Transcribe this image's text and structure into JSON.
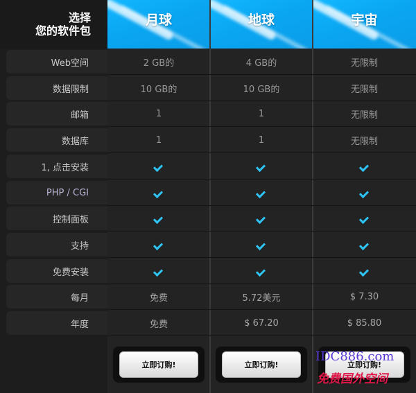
{
  "header": {
    "title_line1": "选择",
    "title_line2": "您的软件包"
  },
  "plans": [
    {
      "name": "月球",
      "values": [
        "2 GB的",
        "10 GB的",
        "1",
        "1"
      ],
      "price_month": "免费",
      "price_year": "免费",
      "button": "立即订购!"
    },
    {
      "name": "地球",
      "values": [
        "4 GB的",
        "10 GB的",
        "1",
        "1"
      ],
      "price_month": "5.72美元",
      "price_year": "$ 67.20",
      "button": "立即订购!"
    },
    {
      "name": "宇宙",
      "values": [
        "无限制",
        "无限制",
        "无限制",
        "无限制"
      ],
      "price_month": "$ 7.30",
      "price_year": "$ 85.80",
      "button": "立即订购!"
    }
  ],
  "features": [
    {
      "label": "Web空间",
      "type": "text",
      "idx": 0
    },
    {
      "label": "数据限制",
      "type": "text",
      "idx": 1
    },
    {
      "label": "邮箱",
      "type": "text",
      "idx": 2
    },
    {
      "label": "数据库",
      "type": "text",
      "idx": 3
    },
    {
      "label": "1, 点击安装",
      "type": "check"
    },
    {
      "label": "PHP / CGI",
      "type": "check"
    },
    {
      "label": "控制面板",
      "type": "check"
    },
    {
      "label": "支持",
      "type": "check"
    },
    {
      "label": "免费安装",
      "type": "check"
    },
    {
      "label": "每月",
      "type": "price_month"
    },
    {
      "label": "年度",
      "type": "price_year"
    }
  ],
  "watermark": {
    "line1": "IDC886.com",
    "line2": "免费国外空间"
  },
  "colors": {
    "accent": "#2ec4f5",
    "header_blue": "#0aa6f2",
    "background": "#1d1d1d"
  }
}
